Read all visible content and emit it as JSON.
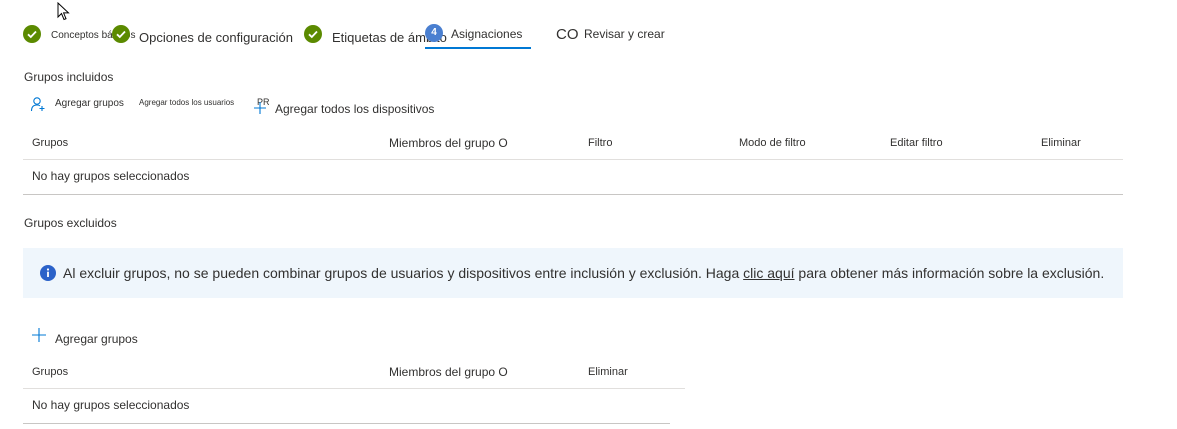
{
  "wizard": {
    "steps": [
      {
        "label": "Conceptos básicos",
        "state": "complete"
      },
      {
        "label": "Opciones de configuración",
        "state": "complete"
      },
      {
        "label": "Etiquetas de ámbito",
        "state": "complete"
      },
      {
        "label": "Asignaciones",
        "state": "current",
        "badge": "4"
      },
      {
        "label": "Revisar y crear",
        "state": "pending",
        "prefix": "CO"
      }
    ]
  },
  "included": {
    "title": "Grupos incluidos",
    "commands": {
      "add_groups": "Agregar grupos",
      "add_all_users": "Agregar todos los usuarios",
      "add_all_users_suffix": "PR",
      "add_all_devices": "Agregar todos los dispositivos"
    },
    "columns": [
      "Grupos",
      "Miembros del grupo O",
      "Filtro",
      "Modo de filtro",
      "Editar filtro",
      "Eliminar"
    ],
    "empty": "No hay grupos seleccionados"
  },
  "excluded": {
    "title": "Grupos excluidos",
    "info": {
      "text_before": "Al excluir grupos, no se pueden combinar grupos de usuarios y dispositivos entre inclusión y exclusión. Haga ",
      "link": "clic aquí",
      "text_after": " para obtener más información sobre la exclusión."
    },
    "commands": {
      "add_groups": "Agregar grupos"
    },
    "columns": [
      "Grupos",
      "Miembros del grupo O",
      "Eliminar"
    ],
    "empty": "No hay grupos seleccionados"
  },
  "colors": {
    "complete": "#5b8a00",
    "current": "#4a7fd0",
    "accent": "#0078d4",
    "info_bg": "#eff6fc",
    "info_icon": "#2b62c9"
  },
  "icons": [
    "mouse-pointer-icon",
    "checkmark-icon",
    "person-add-icon",
    "plus-icon",
    "info-icon"
  ]
}
